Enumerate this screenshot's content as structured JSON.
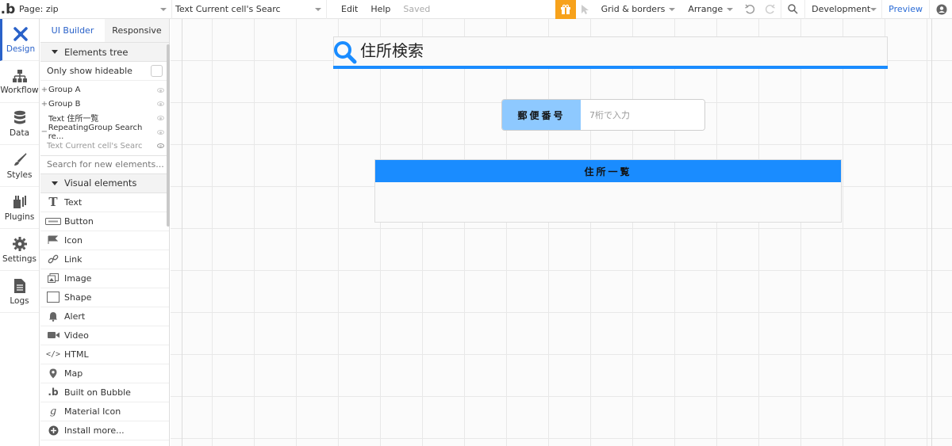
{
  "topbar": {
    "page_label": "Page: zip",
    "element_select": "Text Current cell's Searc",
    "edit": "Edit",
    "help": "Help",
    "status": "Saved",
    "grid_borders": "Grid & borders",
    "arrange": "Arrange",
    "development": "Development",
    "preview": "Preview"
  },
  "rail": {
    "items": [
      {
        "label": "Design",
        "icon": "design-icon"
      },
      {
        "label": "Workflow",
        "icon": "workflow-icon"
      },
      {
        "label": "Data",
        "icon": "database-icon"
      },
      {
        "label": "Styles",
        "icon": "brush-icon"
      },
      {
        "label": "Plugins",
        "icon": "plugin-icon"
      },
      {
        "label": "Settings",
        "icon": "gear-icon"
      },
      {
        "label": "Logs",
        "icon": "document-icon"
      }
    ]
  },
  "palette": {
    "tabs": [
      "UI Builder",
      "Responsive"
    ],
    "elements_tree": "Elements tree",
    "only_show_hideable": "Only show hideable",
    "tree": [
      {
        "prefix": "+",
        "label": "Group A"
      },
      {
        "prefix": "+",
        "label": "Group B"
      },
      {
        "prefix": "",
        "label": "Text 住所一覧"
      },
      {
        "prefix": "−",
        "label": "RepeatingGroup Search re..."
      },
      {
        "prefix": "",
        "label": "Text Current cell's Searc"
      }
    ],
    "search_placeholder": "Search for new elements...",
    "visual_elements": "Visual elements",
    "visual": [
      {
        "label": "Text",
        "icon": "text-icon"
      },
      {
        "label": "Button",
        "icon": "button-icon"
      },
      {
        "label": "Icon",
        "icon": "flag-icon"
      },
      {
        "label": "Link",
        "icon": "link-icon"
      },
      {
        "label": "Image",
        "icon": "image-icon"
      },
      {
        "label": "Shape",
        "icon": "shape-icon"
      },
      {
        "label": "Alert",
        "icon": "bell-icon"
      },
      {
        "label": "Video",
        "icon": "video-icon"
      },
      {
        "label": "HTML",
        "icon": "code-icon"
      },
      {
        "label": "Map",
        "icon": "map-pin-icon"
      },
      {
        "label": "Built on Bubble",
        "icon": "bubble-logo-icon"
      },
      {
        "label": "Material Icon",
        "icon": "material-icon"
      },
      {
        "label": "Install more...",
        "icon": "plus-circle-icon"
      }
    ]
  },
  "canvas": {
    "title": "住所検索",
    "zip_label": "郵便番号",
    "zip_placeholder": "7桁で入力",
    "list_header": "住所一覧"
  },
  "colors": {
    "accent": "#1a8cff",
    "zip_label_bg": "#8ec9ff",
    "brand_blue": "#2a62c9",
    "gift_orange": "#f7a21b"
  }
}
